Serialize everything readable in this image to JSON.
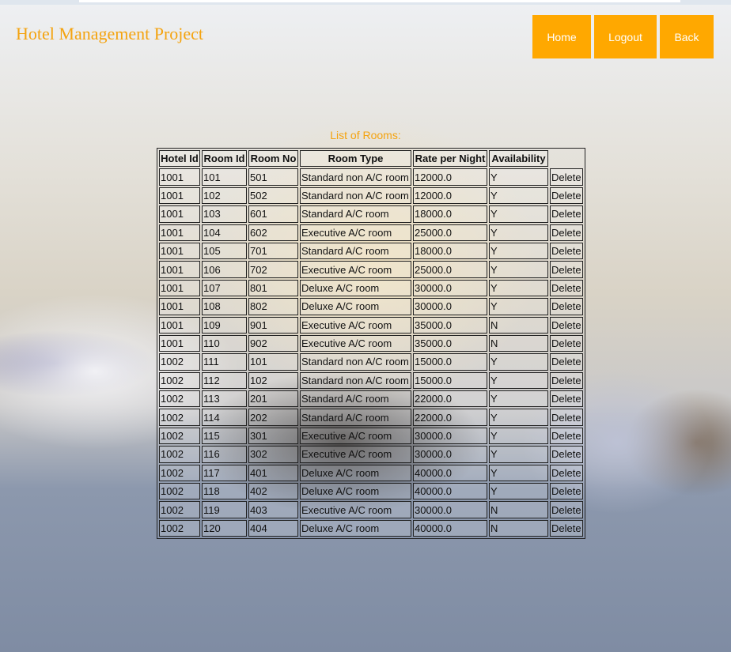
{
  "header": {
    "title": "Hotel Management Project",
    "nav": {
      "home_label": "Home",
      "logout_label": "Logout",
      "back_label": "Back"
    }
  },
  "colors": {
    "accent": "#ffa800",
    "title_text": "#f4a30f"
  },
  "rooms_table": {
    "caption": "List of Rooms:",
    "columns": [
      "Hotel Id",
      "Room Id",
      "Room No",
      "Room Type",
      "Rate per Night",
      "Availability"
    ],
    "delete_label": "Delete",
    "rows": [
      [
        "1001",
        "101",
        "501",
        "Standard non A/C room",
        "12000.0",
        "Y"
      ],
      [
        "1001",
        "102",
        "502",
        "Standard non A/C room",
        "12000.0",
        "Y"
      ],
      [
        "1001",
        "103",
        "601",
        "Standard A/C room",
        "18000.0",
        "Y"
      ],
      [
        "1001",
        "104",
        "602",
        "Executive A/C room",
        "25000.0",
        "Y"
      ],
      [
        "1001",
        "105",
        "701",
        "Standard A/C room",
        "18000.0",
        "Y"
      ],
      [
        "1001",
        "106",
        "702",
        "Executive A/C room",
        "25000.0",
        "Y"
      ],
      [
        "1001",
        "107",
        "801",
        "Deluxe A/C room",
        "30000.0",
        "Y"
      ],
      [
        "1001",
        "108",
        "802",
        "Deluxe A/C room",
        "30000.0",
        "Y"
      ],
      [
        "1001",
        "109",
        "901",
        "Executive A/C room",
        "35000.0",
        "N"
      ],
      [
        "1001",
        "110",
        "902",
        "Executive A/C room",
        "35000.0",
        "N"
      ],
      [
        "1002",
        "111",
        "101",
        "Standard non A/C room",
        "15000.0",
        "Y"
      ],
      [
        "1002",
        "112",
        "102",
        "Standard non A/C room",
        "15000.0",
        "Y"
      ],
      [
        "1002",
        "113",
        "201",
        "Standard A/C room",
        "22000.0",
        "Y"
      ],
      [
        "1002",
        "114",
        "202",
        "Standard A/C room",
        "22000.0",
        "Y"
      ],
      [
        "1002",
        "115",
        "301",
        "Executive A/C room",
        "30000.0",
        "Y"
      ],
      [
        "1002",
        "116",
        "302",
        "Executive A/C room",
        "30000.0",
        "Y"
      ],
      [
        "1002",
        "117",
        "401",
        "Deluxe A/C room",
        "40000.0",
        "Y"
      ],
      [
        "1002",
        "118",
        "402",
        "Deluxe A/C room",
        "40000.0",
        "Y"
      ],
      [
        "1002",
        "119",
        "403",
        "Executive A/C room",
        "30000.0",
        "N"
      ],
      [
        "1002",
        "120",
        "404",
        "Deluxe A/C room",
        "40000.0",
        "N"
      ]
    ]
  }
}
